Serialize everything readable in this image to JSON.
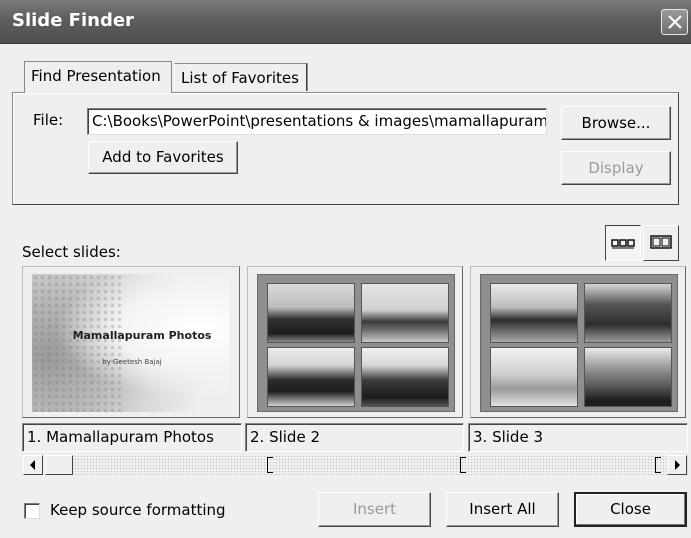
{
  "window": {
    "title": "Slide Finder"
  },
  "tabs": [
    {
      "label": "Find Presentation",
      "active": true
    },
    {
      "label": "List of Favorites",
      "active": false
    }
  ],
  "file": {
    "label": "File:",
    "value": "C:\\Books\\PowerPoint\\presentations & images\\mamallapuram photos.ppt"
  },
  "buttons": {
    "browse": "Browse...",
    "add_favorites": "Add to Favorites",
    "display": "Display",
    "insert": "Insert",
    "insert_all": "Insert All",
    "close": "Close"
  },
  "select_slides_label": "Select slides:",
  "view_toggles": [
    {
      "icon": "slide-sorter-view-icon",
      "pressed": true
    },
    {
      "icon": "filmstrip-view-icon",
      "pressed": false
    }
  ],
  "slides": [
    {
      "caption": "1. Mamallapuram Photos",
      "thumb_title": "Mamallapuram Photos",
      "thumb_subtitle": "by Geetesh Bajaj"
    },
    {
      "caption": "2. Slide 2"
    },
    {
      "caption": "3. Slide 3"
    }
  ],
  "keep_source_formatting": {
    "label": "Keep source formatting",
    "checked": false
  }
}
